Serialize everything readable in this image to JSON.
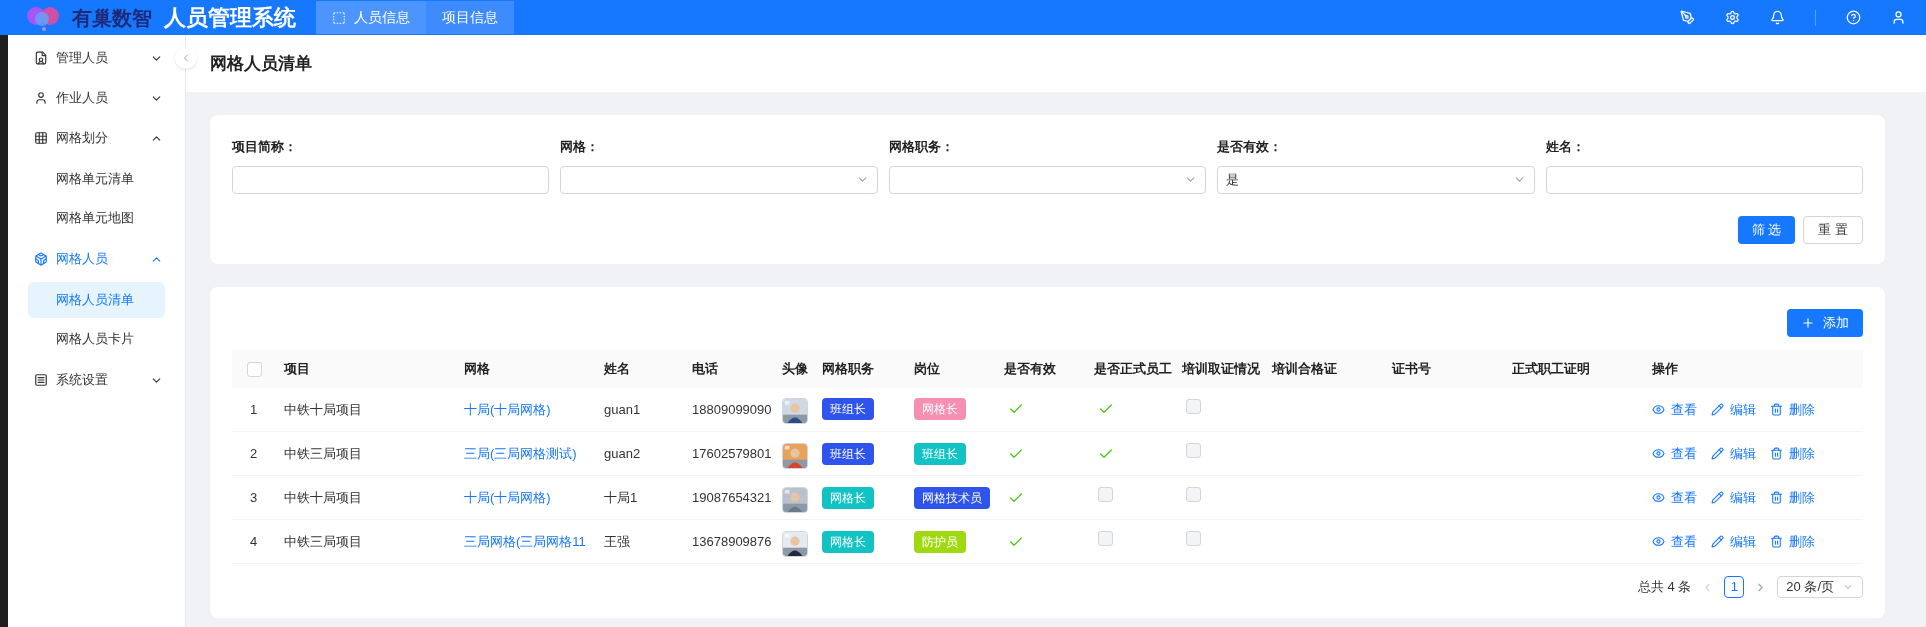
{
  "header": {
    "logo_text": "有巢数智",
    "app_title": "人员管理系统",
    "nav": [
      {
        "label": "人员信息",
        "selected": true
      },
      {
        "label": "项目信息",
        "selected": false
      }
    ]
  },
  "sidebar": {
    "items": [
      {
        "label": "管理人员",
        "expanded": false,
        "selected": false
      },
      {
        "label": "作业人员",
        "expanded": false,
        "selected": false
      },
      {
        "label": "网格划分",
        "expanded": true,
        "selected": false,
        "children": [
          {
            "label": "网格单元清单",
            "selected": false
          },
          {
            "label": "网格单元地图",
            "selected": false
          }
        ]
      },
      {
        "label": "网格人员",
        "expanded": true,
        "selected": true,
        "children": [
          {
            "label": "网格人员清单",
            "selected": true
          },
          {
            "label": "网格人员卡片",
            "selected": false
          }
        ]
      },
      {
        "label": "系统设置",
        "expanded": false,
        "selected": false
      }
    ]
  },
  "page_title": "网格人员清单",
  "filters": [
    {
      "label": "项目简称：",
      "kind": "input"
    },
    {
      "label": "网格：",
      "kind": "select"
    },
    {
      "label": "网格职务：",
      "kind": "select"
    },
    {
      "label": "是否有效：",
      "kind": "select",
      "value": "是"
    },
    {
      "label": "姓名：",
      "kind": "input"
    }
  ],
  "filter_buttons": [
    {
      "label": "筛 选",
      "kind": "primary"
    },
    {
      "label": "重 置",
      "kind": "default"
    }
  ],
  "add_button": "添加",
  "table": {
    "all_selected": false,
    "columns": [
      "项目",
      "网格",
      "姓名",
      "电话",
      "头像",
      "网格职务",
      "岗位",
      "是否有效",
      "是否正式员工",
      "培训取证情况",
      "培训合格证",
      "证书号",
      "正式职工证明",
      "操作"
    ],
    "rows": [
      {
        "index": "1",
        "project": "中铁十局项目",
        "grid": "十局(十局网格)",
        "name": "guan1",
        "phone": "18809099090",
        "duty": {
          "label": "班组长",
          "color": "#2f54eb"
        },
        "post": {
          "label": "网格长",
          "color": "#f78fb3"
        },
        "valid": true,
        "formal": true,
        "training": false,
        "actions": [
          "查看",
          "编辑",
          "删除"
        ]
      },
      {
        "index": "2",
        "project": "中铁三局项目",
        "grid": "三局(三局网格测试)",
        "name": "guan2",
        "phone": "17602579801",
        "duty": {
          "label": "班组长",
          "color": "#2f54eb"
        },
        "post": {
          "label": "班组长",
          "color": "#13c2c2"
        },
        "valid": true,
        "formal": true,
        "training": false,
        "actions": [
          "查看",
          "编辑",
          "删除"
        ]
      },
      {
        "index": "3",
        "project": "中铁十局项目",
        "grid": "十局(十局网格)",
        "name": "十局1",
        "phone": "19087654321",
        "duty": {
          "label": "网格长",
          "color": "#13c2c2"
        },
        "post": {
          "label": "网格技术员",
          "color": "#2f54eb"
        },
        "valid": true,
        "formal": false,
        "training": false,
        "actions": [
          "查看",
          "编辑",
          "删除"
        ]
      },
      {
        "index": "4",
        "project": "中铁三局项目",
        "grid": "三局网格(三局网格11",
        "name": "王强",
        "phone": "13678909876",
        "duty": {
          "label": "网格长",
          "color": "#13c2c2"
        },
        "post": {
          "label": "防护员",
          "color": "#a0d911"
        },
        "valid": true,
        "formal": false,
        "training": false,
        "actions": [
          "查看",
          "编辑",
          "删除"
        ]
      }
    ]
  },
  "pagination": {
    "total": "总共 4 条",
    "pages": [
      {
        "label": "1",
        "selected": true
      }
    ],
    "page_size": "20 条/页"
  }
}
